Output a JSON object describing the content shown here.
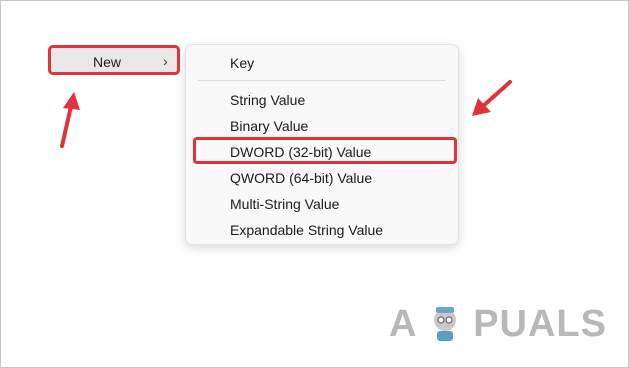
{
  "submenu_trigger": {
    "label": "New",
    "chevron": "chevron-right-icon"
  },
  "menu": {
    "items": [
      {
        "label": "Key"
      },
      {
        "label": "String Value"
      },
      {
        "label": "Binary Value"
      },
      {
        "label": "DWORD (32-bit) Value",
        "highlighted": true
      },
      {
        "label": "QWORD (64-bit) Value"
      },
      {
        "label": "Multi-String Value"
      },
      {
        "label": "Expandable String Value"
      }
    ]
  },
  "watermark": {
    "text_a": "A",
    "text_b": "PUALS",
    "logo": "appuals-mascot-logo"
  },
  "colors": {
    "highlight_red": "#e0343a",
    "menu_bg": "#f9f9f9",
    "arrow_red": "#e0343a"
  }
}
